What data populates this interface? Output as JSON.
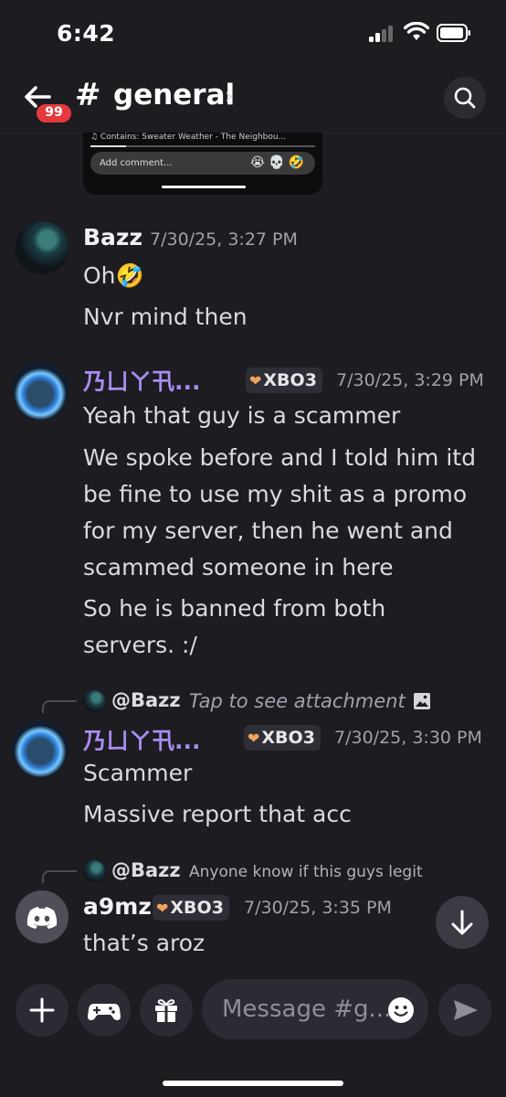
{
  "status_bar": {
    "time": "6:42"
  },
  "header": {
    "badge_count": "99",
    "channel_name": "general",
    "chevron": "›"
  },
  "previous_attachment": {
    "caption": "♫ Contains: Sweater Weather - The Neighbou...",
    "comment_placeholder": "Add comment...",
    "emojis": "😭💀🤣",
    "progress": 0.16
  },
  "messages": [
    {
      "author": "Bazz",
      "timestamp": "7/30/25, 3:27 PM",
      "lines": [
        "Oh🤣",
        "Nvr mind then"
      ]
    },
    {
      "author": "乃ㄩㄚ卂...",
      "tag": "XBO3",
      "timestamp": "7/30/25, 3:29 PM",
      "lines": [
        "Yeah that guy is a scammer",
        "We spoke before and I told him itd",
        "be fine to use my shit as a promo",
        "for my server, then he went and",
        "scammed someone in here",
        "So he is banned from both",
        "servers. :/"
      ]
    },
    {
      "reply_to": "@Bazz",
      "reply_text": "Tap to see attachment",
      "author": "乃ㄩㄚ卂...",
      "tag": "XBO3",
      "timestamp": "7/30/25, 3:30 PM",
      "lines": [
        "Scammer",
        "Massive report that acc"
      ]
    },
    {
      "reply_to": "@Bazz",
      "reply_text": "Anyone know if this guys legit",
      "author": "a9mz",
      "tag": "XBO3",
      "timestamp": "7/30/25, 3:35 PM",
      "lines": [
        "that’s aroz"
      ]
    }
  ],
  "composer": {
    "placeholder": "Message #g..."
  },
  "colors": {
    "background": "#1c1c21",
    "badge": "#e5393d",
    "purple_name": "#a88cf0",
    "tag_heart": "#f2a35b"
  },
  "icons": [
    "back-arrow-icon",
    "hash-icon",
    "search-icon",
    "plus-icon",
    "gamepad-icon",
    "gift-icon",
    "emoji-icon",
    "send-icon",
    "arrow-down-icon",
    "image-icon",
    "discord-logo-icon"
  ]
}
